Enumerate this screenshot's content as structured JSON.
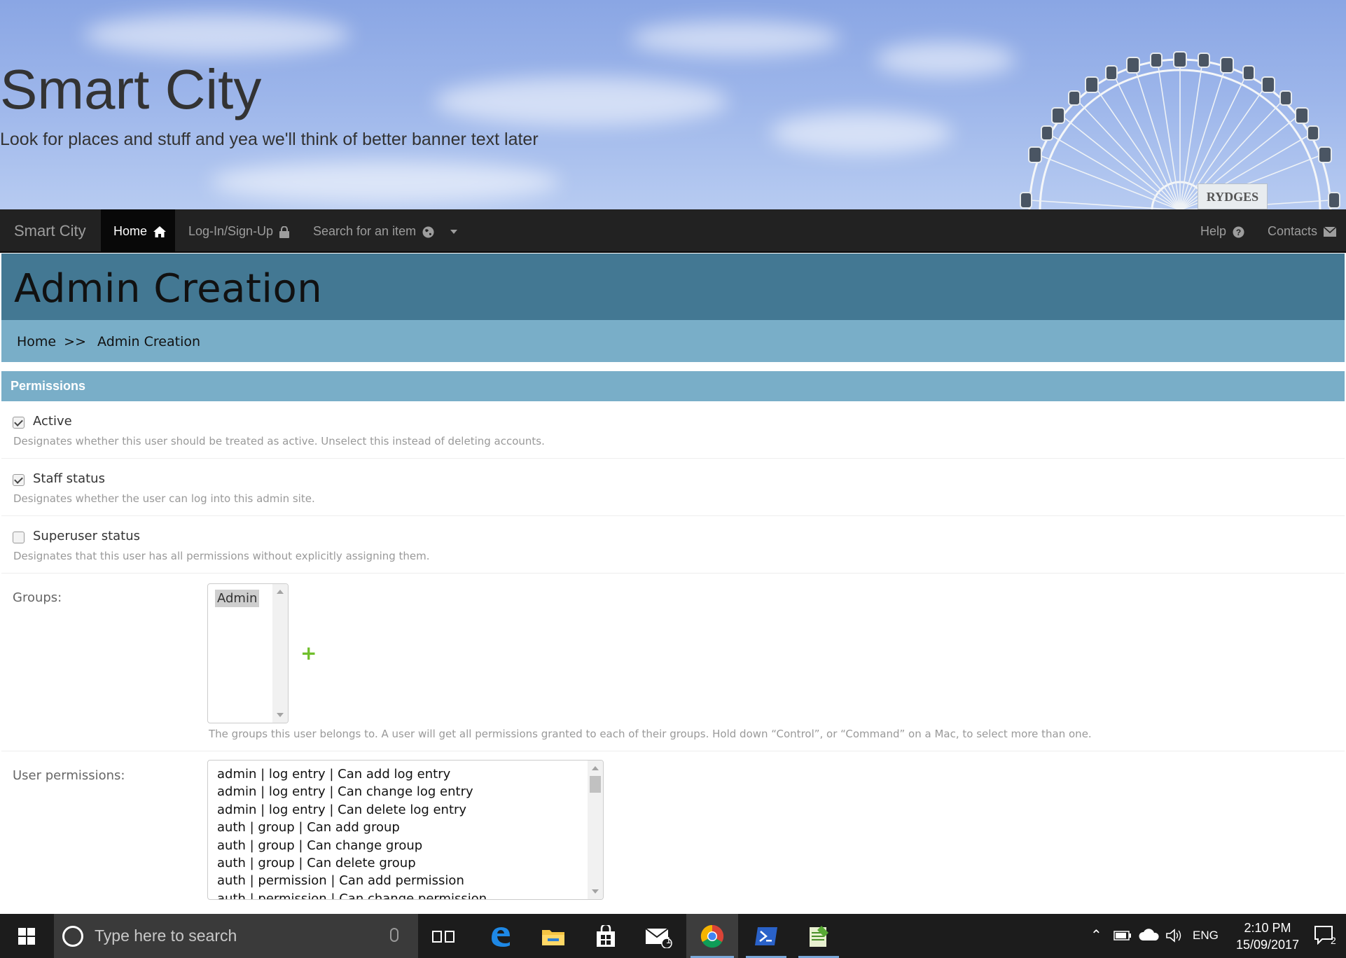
{
  "banner": {
    "title": "Smart City",
    "subtitle": "Look for places and stuff and yea we'll think of better banner text later",
    "sign_text": "RYDGES"
  },
  "navbar": {
    "brand": "Smart City",
    "items": [
      {
        "label": "Home",
        "icon": "home-icon",
        "active": true
      },
      {
        "label": "Log-In/Sign-Up",
        "icon": "lock-icon"
      },
      {
        "label": "Search for an item",
        "icon": "globe-icon",
        "dropdown": true
      }
    ],
    "right_items": [
      {
        "label": "Help",
        "icon": "question-circle-icon"
      },
      {
        "label": "Contacts",
        "icon": "envelope-icon"
      }
    ]
  },
  "page": {
    "title": "Admin Creation",
    "breadcrumb": {
      "home": "Home",
      "separator": ">>",
      "current": "Admin Creation"
    }
  },
  "permissions": {
    "heading": "Permissions",
    "active": {
      "label": "Active",
      "checked": true,
      "help": "Designates whether this user should be treated as active. Unselect this instead of deleting accounts."
    },
    "staff": {
      "label": "Staff status",
      "checked": true,
      "help": "Designates whether the user can log into this admin site."
    },
    "superuser": {
      "label": "Superuser status",
      "checked": false,
      "help": "Designates that this user has all permissions without explicitly assigning them."
    },
    "groups": {
      "label": "Groups:",
      "options": [
        "Admin"
      ],
      "selected": "Admin",
      "add_symbol": "+",
      "help": "The groups this user belongs to. A user will get all permissions granted to each of their groups. Hold down “Control”, or “Command” on a Mac, to select more than one."
    },
    "user_permissions": {
      "label": "User permissions:",
      "options": [
        "admin | log entry | Can add log entry",
        "admin | log entry | Can change log entry",
        "admin | log entry | Can delete log entry",
        "auth | group | Can add group",
        "auth | group | Can change group",
        "auth | group | Can delete group",
        "auth | permission | Can add permission",
        "auth | permission | Can change permission"
      ]
    }
  },
  "taskbar": {
    "search_placeholder": "Type here to search",
    "apps": [
      "task-view-icon",
      "edge-icon",
      "file-explorer-icon",
      "store-icon",
      "mail-icon",
      "chrome-icon",
      "powershell-icon",
      "notepad-icon"
    ],
    "mail_badge": "1",
    "language": "ENG",
    "time": "2:10 PM",
    "date": "15/09/2017",
    "notification_count": "2"
  },
  "colors": {
    "navbar": "#222222",
    "page_header": "#437893",
    "breadcrumb_bar": "#79aec8",
    "add_link": "#70bf2b",
    "taskbar": "#1c1c1c"
  }
}
